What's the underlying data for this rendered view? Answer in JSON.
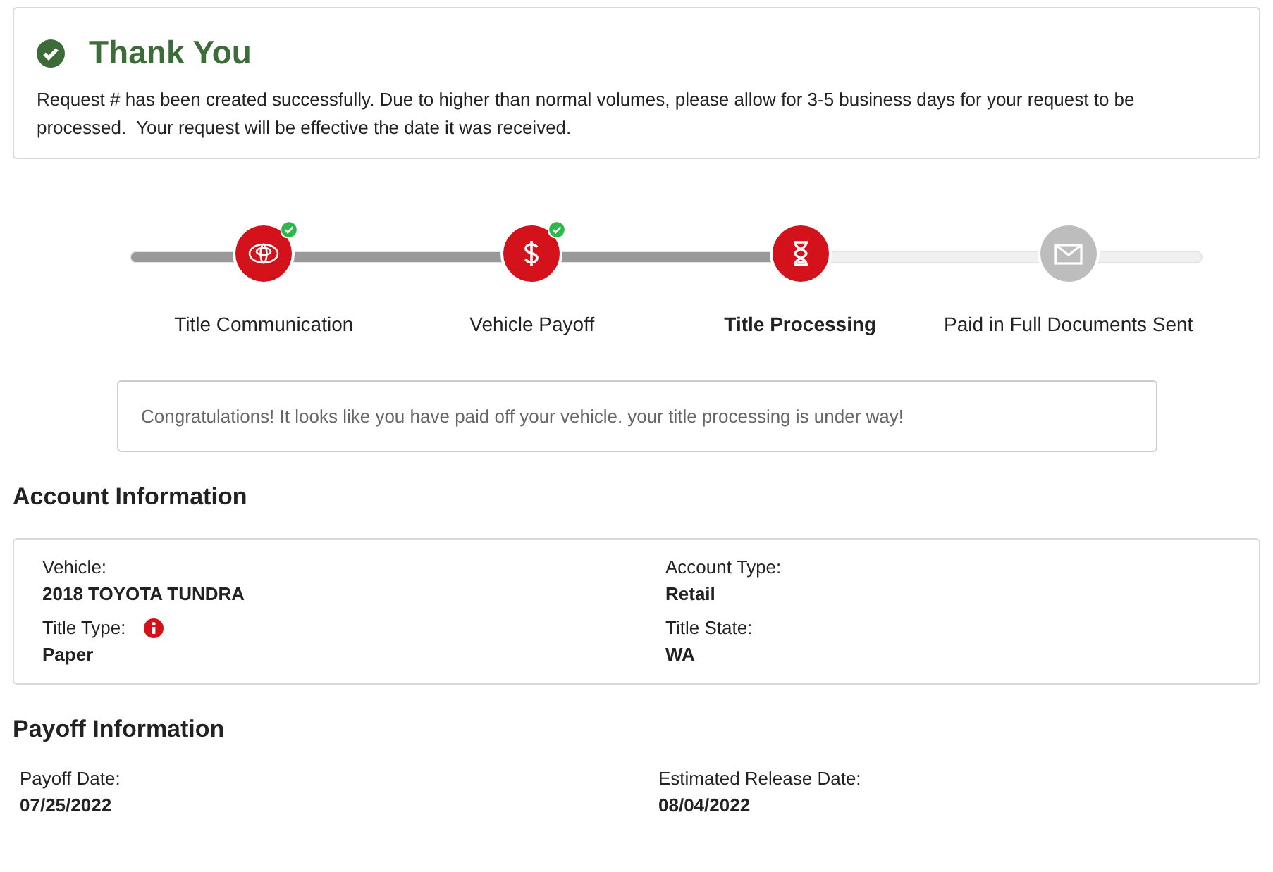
{
  "confirmation": {
    "title": "Thank You",
    "message": "Request # has been created successfully. Due to higher than normal volumes, please allow for 3-5 business days for your request to be processed.  Your request will be effective the date it was received."
  },
  "steps": [
    {
      "label": "Title Communication",
      "kind": "logo",
      "completed": true,
      "current": false
    },
    {
      "label": "Vehicle Payoff",
      "kind": "dollar",
      "completed": true,
      "current": false
    },
    {
      "label": "Title Processing",
      "kind": "hourglass",
      "completed": false,
      "current": true
    },
    {
      "label": "Paid in Full Documents Sent",
      "kind": "envelope",
      "completed": false,
      "current": false
    }
  ],
  "notice": "Congratulations! It looks like you have paid off your vehicle. your title processing is under way!",
  "account": {
    "heading": "Account Information",
    "fields": [
      {
        "label": "Vehicle:",
        "value": "2018 TOYOTA TUNDRA",
        "info": false
      },
      {
        "label": "Account Type:",
        "value": "Retail",
        "info": false
      },
      {
        "label": "Title Type:",
        "value": "Paper",
        "info": true
      },
      {
        "label": "Title State:",
        "value": "WA",
        "info": false
      }
    ]
  },
  "payoff": {
    "heading": "Payoff Information",
    "fields": [
      {
        "label": "Payoff Date:",
        "value": "07/25/2022"
      },
      {
        "label": "Estimated Release Date:",
        "value": "08/04/2022"
      }
    ]
  }
}
